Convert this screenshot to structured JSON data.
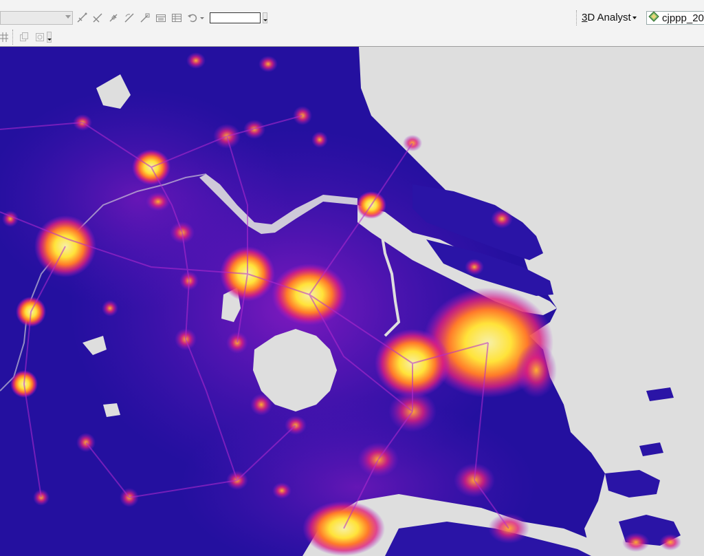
{
  "toolbar": {
    "combo_value": "",
    "scale_value": "",
    "analyst_label_prefix": "3",
    "analyst_label_rest": "D Analyst",
    "layer_name": "cjppp_20",
    "icons_row1": [
      "edit-vertices-icon",
      "reshape-icon",
      "split-icon",
      "rotate-icon",
      "attributes-icon",
      "sketch-properties-icon",
      "table-icon",
      "undo-icon"
    ],
    "icons_row2": [
      "grid-icon",
      "copy-icon",
      "paste-icon"
    ]
  },
  "map": {
    "land_background": "#1f0f9e",
    "water_color": "#dedede",
    "hotspot_colors": [
      "#f3ea9a",
      "#ffe33a",
      "#ff7a2a",
      "#e0207c",
      "#a41bcf"
    ]
  }
}
